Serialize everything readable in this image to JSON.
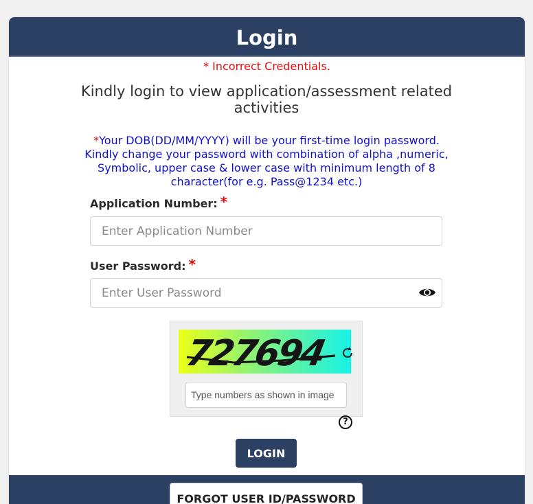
{
  "header": {
    "title": "Login"
  },
  "messages": {
    "error": "* Incorrect Credentials.",
    "intro": "Kindly login to view application/assessment related activities",
    "note_star": "*",
    "note": "Your DOB(DD/MM/YYYY) will be your first-time login password. Kindly change your password with combination of alpha ,numeric, Symbolic, upper case & lower case with minimum length of 8 character(for e.g. Pass@1234 etc.)"
  },
  "form": {
    "application_number": {
      "label": "Application Number:",
      "required_mark": "*",
      "placeholder": "Enter Application Number",
      "value": ""
    },
    "password": {
      "label": "User Password:",
      "required_mark": "*",
      "placeholder": "Enter User Password",
      "value": ""
    },
    "captcha": {
      "image_text": "727694",
      "placeholder": "Type numbers as shown in image",
      "value": "",
      "help_glyph": "?"
    }
  },
  "buttons": {
    "login": "LOGIN",
    "forgot": "FORGOT USER ID/PASSWORD"
  },
  "icons": {
    "password_toggle": "eye-icon",
    "captcha_refresh": "refresh-icon",
    "captcha_help": "question-circle-icon"
  },
  "colors": {
    "primary": "#2c4063",
    "error": "#e30f0f",
    "note": "#1111c8"
  }
}
